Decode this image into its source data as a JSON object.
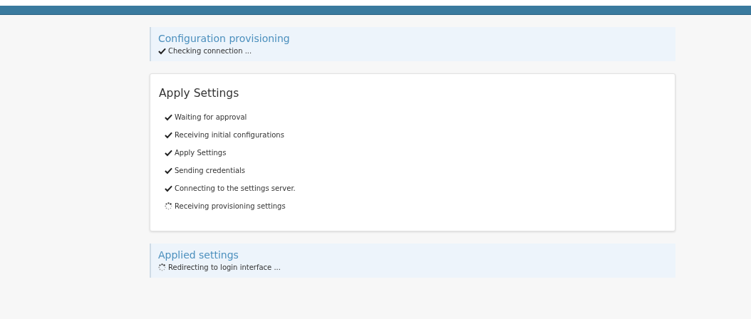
{
  "sections": [
    {
      "kind": "info",
      "title": "Configuration provisioning",
      "steps": [
        {
          "label": "Checking connection ...",
          "done": true
        }
      ]
    },
    {
      "kind": "card",
      "title": "Apply Settings",
      "steps": [
        {
          "label": "Waiting for approval",
          "done": true
        },
        {
          "label": "Receiving initial configurations",
          "done": true
        },
        {
          "label": "Apply Settings",
          "done": true
        },
        {
          "label": "Sending credentials",
          "done": true
        },
        {
          "label": "Connecting to the settings server.",
          "done": true
        },
        {
          "label": "Receiving provisioning settings",
          "done": false
        }
      ]
    },
    {
      "kind": "info",
      "title": "Applied settings",
      "steps": [
        {
          "label": "Redirecting to login interface ...",
          "done": false
        }
      ]
    }
  ]
}
